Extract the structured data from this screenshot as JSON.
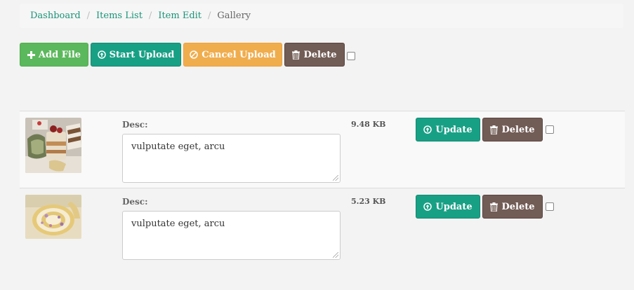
{
  "breadcrumb": [
    {
      "label": "Dashboard",
      "active": false
    },
    {
      "label": "Items List",
      "active": false
    },
    {
      "label": "Item Edit",
      "active": false
    },
    {
      "label": "Gallery",
      "active": true
    }
  ],
  "breadcrumb_separator": "/",
  "toolbar": {
    "add_file": "Add File",
    "start_upload": "Start Upload",
    "cancel_upload": "Cancel Upload",
    "delete": "Delete",
    "select_all_checked": false
  },
  "colors": {
    "success": "#5cb85c",
    "primary": "#18a085",
    "warning": "#f0ad4e",
    "danger": "#725c56",
    "link": "#1a9477"
  },
  "files": [
    {
      "thumbnail": "cake-slices-image",
      "desc_label": "Desc:",
      "desc_value": "vulputate eget, arcu",
      "size": "9.48 KB",
      "update_label": "Update",
      "delete_label": "Delete",
      "checked": false
    },
    {
      "thumbnail": "swiss-roll-image",
      "desc_label": "Desc:",
      "desc_value": "vulputate eget, arcu",
      "size": "5.23 KB",
      "update_label": "Update",
      "delete_label": "Delete",
      "checked": false
    }
  ]
}
